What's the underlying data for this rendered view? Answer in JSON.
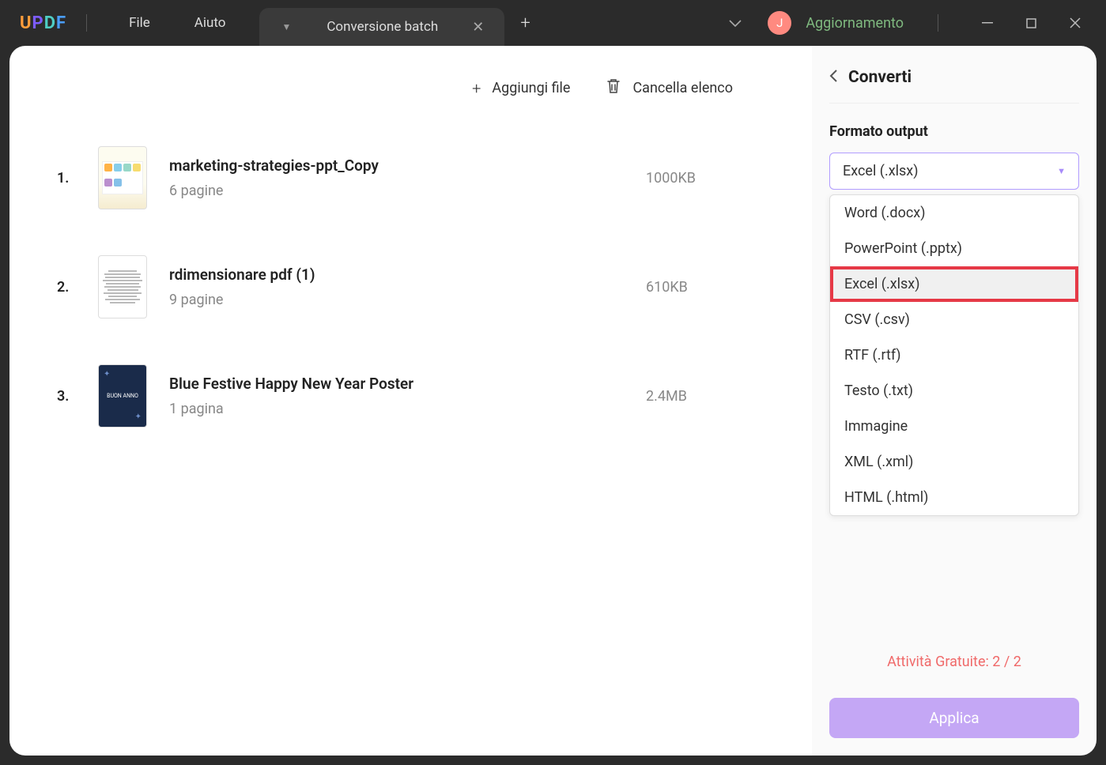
{
  "titlebar": {
    "menu_file": "File",
    "menu_help": "Aiuto",
    "tab_label": "Conversione batch",
    "update_label": "Aggiornamento",
    "avatar_initial": "J"
  },
  "toolbar": {
    "add_file": "Aggiungi file",
    "clear_list": "Cancella elenco"
  },
  "files": [
    {
      "num": "1.",
      "name": "marketing-strategies-ppt_Copy",
      "pages": "6 pagine",
      "size": "1000KB"
    },
    {
      "num": "2.",
      "name": "rdimensionare pdf (1)",
      "pages": "9 pagine",
      "size": "610KB"
    },
    {
      "num": "3.",
      "name": "Blue Festive Happy New Year Poster",
      "pages": "1 pagina",
      "size": "2.4MB"
    }
  ],
  "panel": {
    "title": "Converti",
    "format_label": "Formato output",
    "selected": "Excel (.xlsx)",
    "options": [
      "Word (.docx)",
      "PowerPoint (.pptx)",
      "Excel (.xlsx)",
      "CSV (.csv)",
      "RTF (.rtf)",
      "Testo (.txt)",
      "Immagine",
      "XML (.xml)",
      "HTML (.html)"
    ],
    "quota": "Attività Gratuite: 2 / 2",
    "apply": "Applica"
  },
  "thumb3_text": "BUON ANNO"
}
